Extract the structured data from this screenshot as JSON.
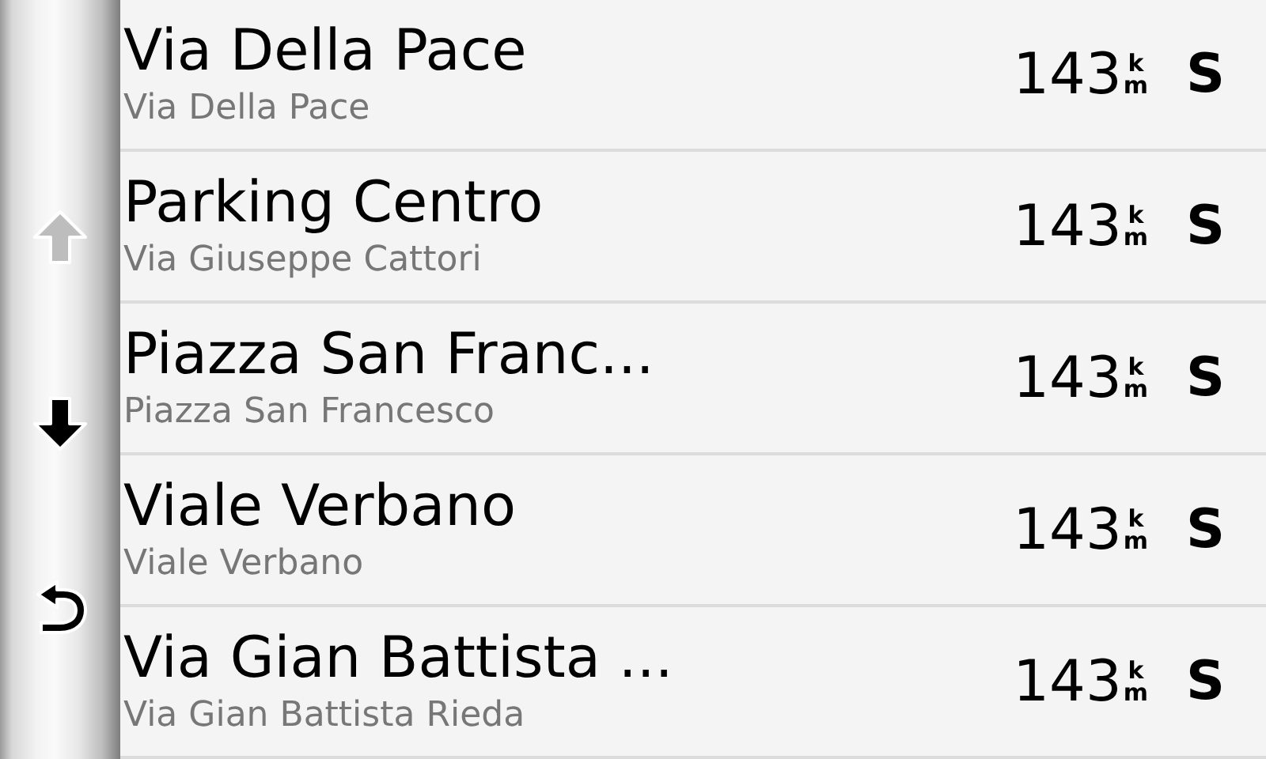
{
  "side_buttons": [
    {
      "kind": "up",
      "disabled": true
    },
    {
      "kind": "down",
      "disabled": false
    },
    {
      "kind": "back",
      "disabled": false
    }
  ],
  "results": [
    {
      "name": "Via Della Pace",
      "address": "Via Della Pace",
      "distance": "143",
      "unit_top": "k",
      "unit_bottom": "m",
      "direction": "S"
    },
    {
      "name": "Parking Centro",
      "address": "Via Giuseppe Cattori",
      "distance": "143",
      "unit_top": "k",
      "unit_bottom": "m",
      "direction": "S"
    },
    {
      "name": "Piazza San Franc...",
      "address": "Piazza San Francesco",
      "distance": "143",
      "unit_top": "k",
      "unit_bottom": "m",
      "direction": "S"
    },
    {
      "name": "Viale Verbano",
      "address": "Viale Verbano",
      "distance": "143",
      "unit_top": "k",
      "unit_bottom": "m",
      "direction": "S"
    },
    {
      "name": "Via Gian Battista ...",
      "address": "Via Gian Battista Rieda",
      "distance": "143",
      "unit_top": "k",
      "unit_bottom": "m",
      "direction": "S"
    }
  ]
}
